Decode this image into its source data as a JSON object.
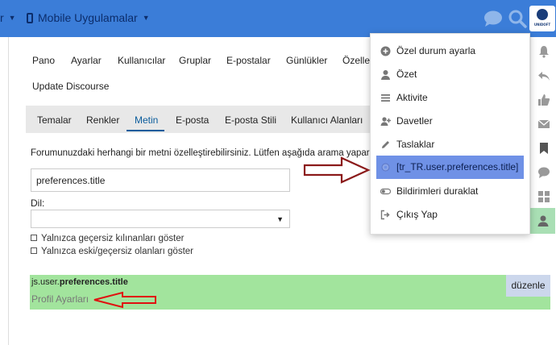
{
  "topbar": {
    "left_partial": "r",
    "mobile_apps": "Mobile Uygulamalar",
    "avatar_brand": "UNIDOFT"
  },
  "admin_nav": {
    "items": [
      "Pano",
      "Ayarlar",
      "Kullanıcılar",
      "Gruplar",
      "E-postalar",
      "Günlükler",
      "Özelleş"
    ],
    "second_row": "Update Discourse"
  },
  "subtabs": {
    "items": [
      "Temalar",
      "Renkler",
      "Metin",
      "E-posta",
      "E-posta Stili",
      "Kullanıcı Alanları"
    ],
    "active": "Metin"
  },
  "customize": {
    "description": "Forumunuzdaki herhangi bir metni özelleştirebilirsiniz. Lütfen aşağıda arama yaparak",
    "search_value": "preferences.title",
    "language_label": "Dil:",
    "language_value": "",
    "checkbox_overridden": "Yalnızca geçersiz kılınanları göster",
    "checkbox_outdated": "Yalnızca eski/geçersiz olanları göster"
  },
  "result": {
    "key_prefix": "js.user.",
    "key_bold": "preferences.title",
    "value": "Profil Ayarları",
    "edit_label": "düzenle"
  },
  "menu": {
    "items": [
      {
        "label": "Özel durum ayarla",
        "icon": "plus-circle-icon"
      },
      {
        "label": "Özet",
        "icon": "user-icon"
      },
      {
        "label": "Aktivite",
        "icon": "stream-icon"
      },
      {
        "label": "Davetler",
        "icon": "user-plus-icon"
      },
      {
        "label": "Taslaklar",
        "icon": "pencil-icon"
      },
      {
        "label": "[tr_TR.user.preferences.title]",
        "icon": "gear-icon"
      },
      {
        "label": "Bildirimleri duraklat",
        "icon": "toggle-icon"
      },
      {
        "label": "Çıkış Yap",
        "icon": "sign-out-icon"
      }
    ],
    "highlighted_index": 5
  },
  "colors": {
    "header": "#3b7dd8",
    "menu_highlight": "#6f91e6",
    "result_bg": "#a2e49d",
    "arrow_red": "#8b1a1a"
  }
}
